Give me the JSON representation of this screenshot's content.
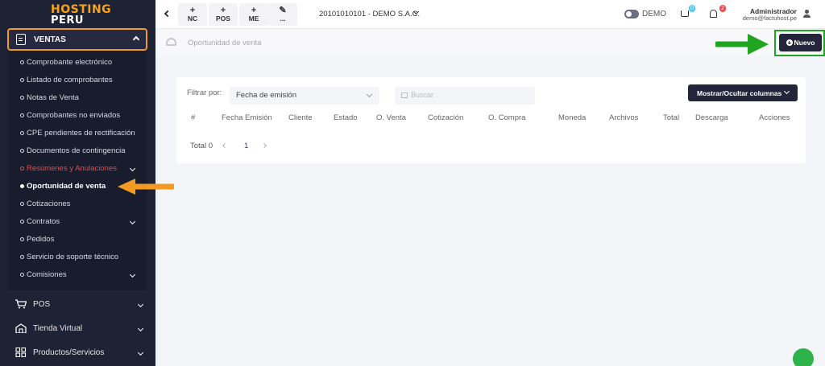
{
  "brand": {
    "line1": "HOSTING",
    "line2": "PERU"
  },
  "sidebar": {
    "section": {
      "label": "VENTAS"
    },
    "submenu": [
      {
        "label": "Comprobante electrónico"
      },
      {
        "label": "Listado de comprobantes"
      },
      {
        "label": "Notas de Venta"
      },
      {
        "label": "Comprobantes no enviados"
      },
      {
        "label": "CPE pendientes de rectificación"
      },
      {
        "label": "Documentos de contingencia"
      },
      {
        "label": "Resúmenes y Anulaciones"
      },
      {
        "label": "Oportunidad de venta"
      },
      {
        "label": "Cotizaciones"
      },
      {
        "label": "Contratos"
      },
      {
        "label": "Pedidos"
      },
      {
        "label": "Servicio de soporte técnico"
      },
      {
        "label": "Comisiones"
      }
    ],
    "main": [
      {
        "label": "POS",
        "icon": "cart-icon"
      },
      {
        "label": "Tienda Virtual",
        "icon": "store-icon"
      },
      {
        "label": "Productos/Servicios",
        "icon": "grid-icon"
      }
    ]
  },
  "topbar": {
    "quick": [
      {
        "symbol": "+",
        "label": "NC"
      },
      {
        "symbol": "+",
        "label": "POS"
      },
      {
        "symbol": "+",
        "label": "ME"
      },
      {
        "symbol": "✎",
        "label": "..."
      }
    ],
    "company": "20101010101 - DEMO S.A.C.",
    "mode_label": "DEMO",
    "cart_count": "0",
    "notif_count": "2",
    "user_name": "Administrador",
    "user_email": "demo@factuhost.pe"
  },
  "page": {
    "title": "Oportunidad de venta",
    "new_button": "Nuevo"
  },
  "filters": {
    "label": "Filtrar por:",
    "selected": "Fecha de emisión",
    "search_placeholder": "Buscar",
    "columns_button": "Mostrar/Ocultar columnas"
  },
  "table": {
    "headers": [
      "#",
      "Fecha Emisión",
      "Cliente",
      "Estado",
      "O. Venta",
      "Cotización",
      "O. Compra",
      "Moneda",
      "Archivos",
      "Total",
      "Descarga",
      "Acciones"
    ],
    "total_label": "Total 0",
    "page": "1"
  },
  "colors": {
    "sidebar_bg": "#1e2235",
    "accent_orange": "#f29a23",
    "accent_green": "#1fa51f",
    "button_dark": "#23263a",
    "active_red": "#e34b4b"
  }
}
